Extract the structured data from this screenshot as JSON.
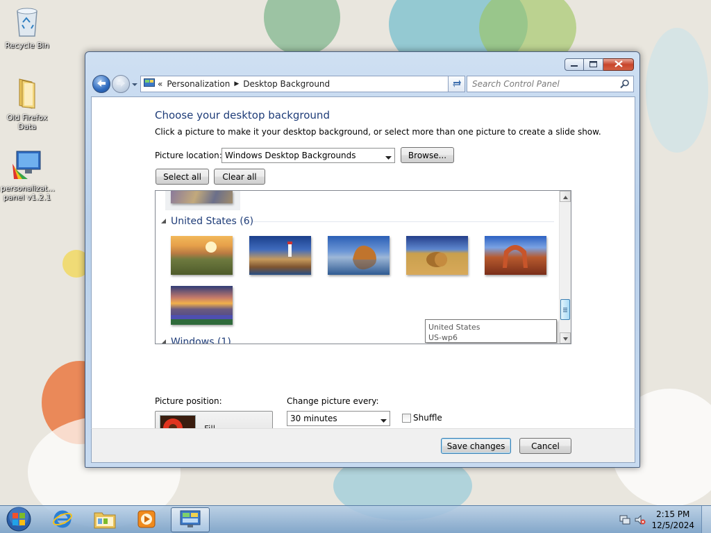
{
  "desktop": {
    "icons": [
      {
        "label": "Recycle Bin",
        "icon": "recycle-bin-icon"
      },
      {
        "label": "Old Firefox Data",
        "icon": "folder-icon"
      },
      {
        "label": "personalizat... panel v1.2.1",
        "icon": "personalization-panel-icon"
      }
    ]
  },
  "window": {
    "breadcrumb": {
      "overflow": "«",
      "items": [
        "Personalization",
        "Desktop Background"
      ]
    },
    "search_placeholder": "Search Control Panel"
  },
  "page": {
    "title": "Choose your desktop background",
    "description": "Click a picture to make it your desktop background, or select more than one picture to create a slide show.",
    "picture_location_label": "Picture location:",
    "picture_location_value": "Windows Desktop Backgrounds",
    "browse_label": "Browse...",
    "select_all_label": "Select all",
    "clear_all_label": "Clear all"
  },
  "gallery": {
    "groups": [
      {
        "name": "United States (6)",
        "pictures": 6
      },
      {
        "name": "Windows (1)",
        "pictures": 1
      }
    ],
    "tooltip": {
      "line1": "United States",
      "line2": "US-wp6"
    }
  },
  "options": {
    "picture_position_label": "Picture position:",
    "picture_position_value": "Fill",
    "change_picture_label": "Change picture every:",
    "change_picture_value": "30 minutes",
    "shuffle_label": "Shuffle",
    "shuffle_checked": false
  },
  "footer": {
    "save_label": "Save changes",
    "cancel_label": "Cancel"
  },
  "taskbar": {
    "time": "2:15 PM",
    "date": "12/5/2024"
  },
  "colors": {
    "heading": "#1e3c78",
    "window_frame": "#b9d0ea",
    "close_button": "#c8452b"
  }
}
